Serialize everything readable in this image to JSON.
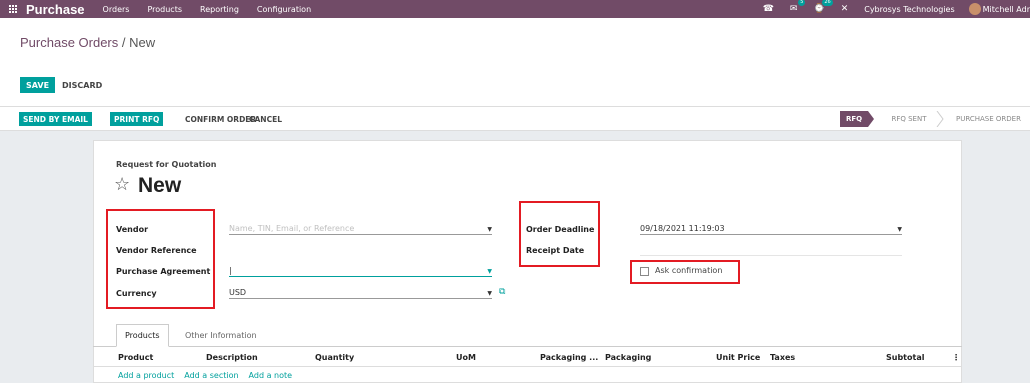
{
  "navbar": {
    "app_name": "Purchase",
    "menu": [
      "Orders",
      "Products",
      "Reporting",
      "Configuration"
    ],
    "icons": {
      "phone": "☎",
      "chat": "✉",
      "activity": "⌚",
      "close": "✕"
    },
    "chat_badge": "5",
    "activity_badge": "26",
    "company": "Cybrosys Technologies",
    "user": "Mitchell Adr"
  },
  "breadcrumb": {
    "parent": "Purchase Orders",
    "separator": " / ",
    "current": "New"
  },
  "actions": {
    "save": "SAVE",
    "discard": "DISCARD"
  },
  "statusbar": {
    "buttons": {
      "send_email": "SEND BY EMAIL",
      "print_rfq": "PRINT RFQ",
      "confirm": "CONFIRM ORDER",
      "cancel": "CANCEL"
    },
    "stages": {
      "rfq": "RFQ",
      "rfq_sent": "RFQ SENT",
      "purchase_order": "PURCHASE ORDER"
    },
    "active_stage": "RFQ"
  },
  "form": {
    "doc_type": "Request for Quotation",
    "star_icon": "☆",
    "doc_name": "New",
    "left_fields": {
      "vendor": {
        "label": "Vendor",
        "placeholder": "Name, TIN, Email, or Reference",
        "value": ""
      },
      "vendor_reference": {
        "label": "Vendor Reference",
        "value": ""
      },
      "purchase_agreement": {
        "label": "Purchase Agreement",
        "value": "|"
      },
      "currency": {
        "label": "Currency",
        "value": "USD"
      }
    },
    "right_fields": {
      "order_deadline": {
        "label": "Order Deadline",
        "value": "09/18/2021 11:19:03"
      },
      "receipt_date": {
        "label": "Receipt Date",
        "value": ""
      },
      "ask_confirmation": {
        "label": "Ask confirmation",
        "checked": false
      }
    },
    "dropdown_icon": "▼",
    "external_link_icon": "⧉"
  },
  "notebook": {
    "tabs": [
      "Products",
      "Other Information"
    ],
    "active_tab": "Products",
    "columns": [
      "Product",
      "Description",
      "Quantity",
      "UoM",
      "Packaging ...",
      "Packaging",
      "Unit Price",
      "Taxes",
      "Subtotal",
      "⋮"
    ],
    "line_actions": [
      "Add a product",
      "Add a section",
      "Add a note"
    ]
  },
  "colors": {
    "brand": "#714b67",
    "primary": "#00a09d",
    "highlight": "#e31b23"
  }
}
